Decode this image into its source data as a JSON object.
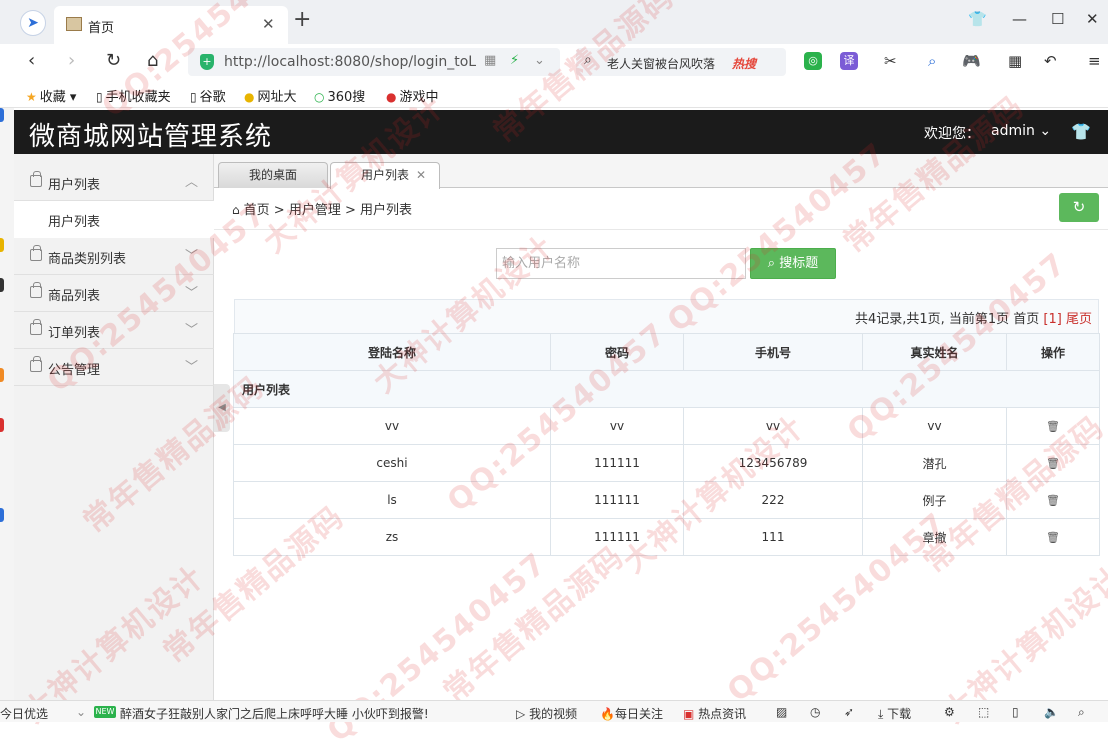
{
  "browser": {
    "tab_title": "首页",
    "url": "http://localhost:8080/shop/login_toL",
    "url_host": "localhost",
    "search_text": "老人关窗被台风吹落",
    "search_hot": "热搜",
    "bookmarks": [
      "收藏",
      "手机收藏夹",
      "谷歌",
      "网址大",
      "360搜",
      "游戏中"
    ]
  },
  "app": {
    "title": "微商城网站管理系统",
    "welcome": "欢迎您：",
    "user": "admin"
  },
  "sidebar": {
    "items": [
      {
        "label": "用户列表",
        "expanded": true
      },
      {
        "label": "商品类别列表",
        "expanded": false
      },
      {
        "label": "商品列表",
        "expanded": false
      },
      {
        "label": "订单列表",
        "expanded": false
      },
      {
        "label": "公告管理",
        "expanded": false
      }
    ],
    "subitem": "用户列表"
  },
  "tabs": {
    "desktop": "我的桌面",
    "active": "用户列表"
  },
  "breadcrumb": {
    "home": "首页",
    "level1": "用户管理",
    "level2": "用户列表"
  },
  "search": {
    "placeholder": "输入用户名称",
    "button": "搜标题"
  },
  "pager": {
    "summary": "共4记录,共1页, 当前第1页 首页",
    "current": "[1]",
    "last": "尾页"
  },
  "table": {
    "caption": "用户列表",
    "headers": [
      "登陆名称",
      "密码",
      "手机号",
      "真实姓名",
      "操作"
    ],
    "rows": [
      [
        "vv",
        "vv",
        "vv",
        "vv"
      ],
      [
        "ceshi",
        "111111",
        "123456789",
        "潜孔"
      ],
      [
        "ls",
        "111111",
        "222",
        "例子"
      ],
      [
        "zs",
        "111111",
        "111",
        "章撤"
      ]
    ]
  },
  "watermark": {
    "qq": "QQ:2545404",
    "qq_full": "QQ:254540457",
    "slogan1": "常年售精品源码",
    "slogan2": "大神计算机设计"
  },
  "statusbar": {
    "left": "今日优选",
    "news": "醉酒女子狂敲别人家门之后爬上床呼呼大睡 小伙吓到报警!",
    "video": "我的视频",
    "follow": "每日关注",
    "hot": "热点资讯",
    "download": "下载"
  },
  "colors": {
    "header": "#1b1b1b",
    "accent_green": "#5cb85c",
    "pager_red": "#c9302c"
  }
}
